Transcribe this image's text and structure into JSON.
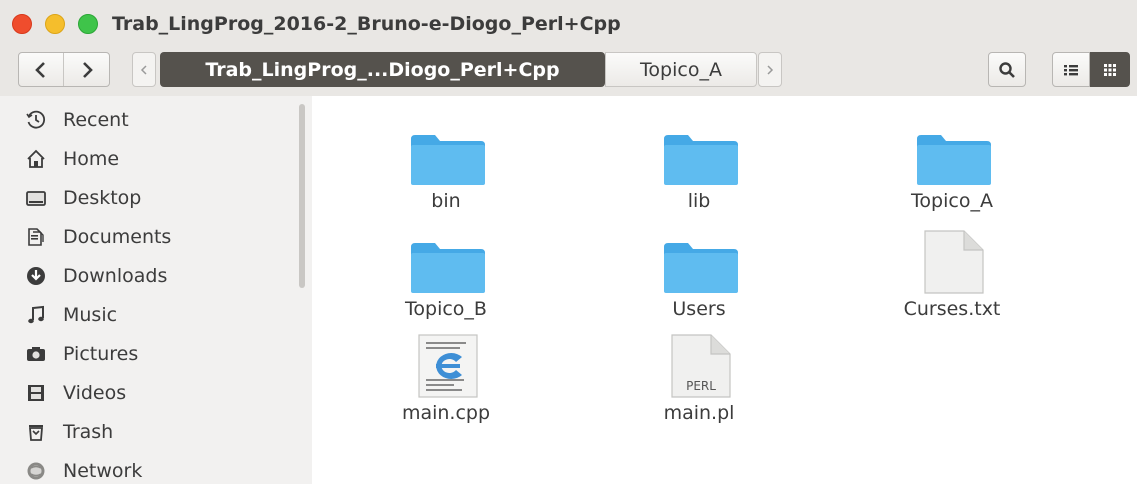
{
  "window": {
    "title": "Trab_LingProg_2016-2_Bruno-e-Diogo_Perl+Cpp",
    "buttons": [
      "close",
      "minimize",
      "maximize"
    ]
  },
  "toolbar": {
    "back_icon": "chevron-left-icon",
    "forward_icon": "chevron-right-icon",
    "breadcrumb": {
      "current": "Trab_LingProg_...Diogo_Perl+Cpp",
      "next": "Topico_A"
    },
    "search_icon": "search-icon",
    "list_view_icon": "list-view-icon",
    "grid_view_icon": "grid-view-icon"
  },
  "sidebar": {
    "items": [
      {
        "label": "Recent",
        "icon": "clock-icon"
      },
      {
        "label": "Home",
        "icon": "home-icon"
      },
      {
        "label": "Desktop",
        "icon": "desktop-icon"
      },
      {
        "label": "Documents",
        "icon": "documents-icon"
      },
      {
        "label": "Downloads",
        "icon": "download-icon"
      },
      {
        "label": "Music",
        "icon": "music-icon"
      },
      {
        "label": "Pictures",
        "icon": "camera-icon"
      },
      {
        "label": "Videos",
        "icon": "film-icon"
      },
      {
        "label": "Trash",
        "icon": "trash-icon"
      },
      {
        "label": "Network",
        "icon": "network-icon"
      }
    ]
  },
  "files": [
    {
      "name": "bin",
      "type": "folder"
    },
    {
      "name": "lib",
      "type": "folder"
    },
    {
      "name": "Topico_A",
      "type": "folder"
    },
    {
      "name": "Topico_B",
      "type": "folder"
    },
    {
      "name": "Users",
      "type": "folder"
    },
    {
      "name": "Curses.txt",
      "type": "text"
    },
    {
      "name": "main.cpp",
      "type": "cpp"
    },
    {
      "name": "main.pl",
      "type": "perl",
      "badge": "PERL"
    }
  ],
  "colors": {
    "folder": "#5fbcf0",
    "active_crumb": "#55524d",
    "close": "#ef4d2d",
    "minimize": "#f5be2c",
    "maximize": "#3fc44a"
  }
}
